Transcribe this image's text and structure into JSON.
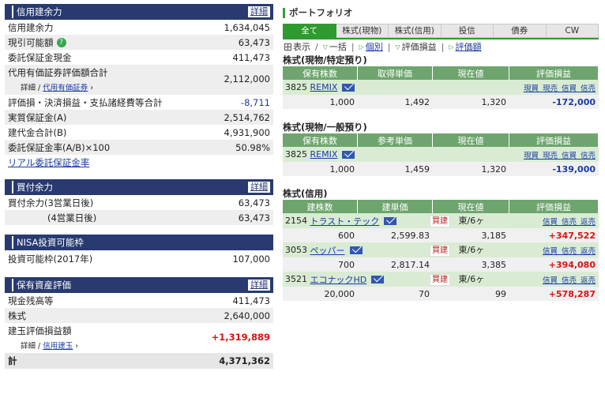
{
  "margin": {
    "title": "信用建余力",
    "more": "詳細",
    "rows": [
      {
        "label": "信用建余力",
        "value": "1,634,045"
      },
      {
        "label": "現引可能額",
        "value": "63,473"
      },
      {
        "label": "委託保証金現金",
        "value": "411,473"
      },
      {
        "label": "代用有価証券評価額合計",
        "value": "2,112,000",
        "sub_prefix": "詳細 / ",
        "sub_link": "代用有価証券"
      },
      {
        "label": "評価損・決済損益・支払諸経費等合計",
        "value": "-8,711"
      },
      {
        "label": "実質保証金(A)",
        "value": "2,514,762"
      },
      {
        "label": "建代金合計(B)",
        "value": "4,931,900"
      },
      {
        "label": "委託保証金率(A/B)×100",
        "value": "50.98%"
      }
    ],
    "realtime_link": "リアル委託保証金率"
  },
  "buying": {
    "title": "買付余力",
    "more": "詳細",
    "rows": [
      {
        "label": "買付余力(3営業日後)",
        "value": "63,473"
      },
      {
        "label": "(4営業日後)",
        "value": "63,473"
      }
    ]
  },
  "nisa": {
    "title": "NISA投資可能枠",
    "rows": [
      {
        "label": "投資可能枠(2017年)",
        "value": "107,000"
      }
    ]
  },
  "assets": {
    "title": "保有資産評価",
    "more": "詳細",
    "rows": [
      {
        "label": "現金残高等",
        "value": "411,473"
      },
      {
        "label": "株式",
        "value": "2,640,000"
      },
      {
        "label": "建玉評価損益額",
        "value": "+1,319,889",
        "sub_prefix": "詳細 / ",
        "sub_link": "信用建玉"
      }
    ],
    "total_label": "計",
    "total_value": "4,371,362"
  },
  "portfolio": {
    "title": "ポートフォリオ",
    "tabs": [
      "全て",
      "株式(現物)",
      "株式(信用)",
      "投信",
      "債券",
      "CW"
    ],
    "toolbar": {
      "display": "表示",
      "collapse": "一括",
      "individual": "個別",
      "pl": "評価損益",
      "valuation": "評価額"
    },
    "spot_specific": {
      "title": "株式(現物/特定預り)",
      "headers": [
        "保有株数",
        "取得単価",
        "現在値",
        "評価損益"
      ],
      "code_name": "3825",
      "name": "REMIX",
      "links": "現買 現売 信買 信売",
      "qty": "1,000",
      "unit": "1,492",
      "price": "1,320",
      "pl": "-172,000"
    },
    "spot_general": {
      "title": "株式(現物/一般預り)",
      "headers": [
        "保有株数",
        "参考単価",
        "現在値",
        "評価損益"
      ],
      "code_name": "3825",
      "name": "REMIX",
      "links": "現買 現売 信買 信売",
      "qty": "1,000",
      "unit": "1,459",
      "price": "1,320",
      "pl": "-139,000"
    },
    "margin": {
      "title": "株式(信用)",
      "headers": [
        "建株数",
        "建単価",
        "現在値",
        "評価損益"
      ],
      "items": [
        {
          "code": "2154",
          "name": "トラスト・テック",
          "kind": "買建",
          "market": "東/6ヶ",
          "links": "信買 信売 返売",
          "qty": "600",
          "unit": "2,599.83",
          "price": "3,185",
          "pl": "+347,522"
        },
        {
          "code": "3053",
          "name": "ペッパー",
          "kind": "買建",
          "market": "東/6ヶ",
          "links": "信買 信売 返売",
          "qty": "700",
          "unit": "2,817.14",
          "price": "3,385",
          "pl": "+394,080"
        },
        {
          "code": "3521",
          "name": "エコナックHD",
          "kind": "買建",
          "market": "東/6ヶ",
          "links": "信買 信売 返売",
          "qty": "20,000",
          "unit": "70",
          "price": "99",
          "pl": "+578,287"
        }
      ]
    }
  }
}
